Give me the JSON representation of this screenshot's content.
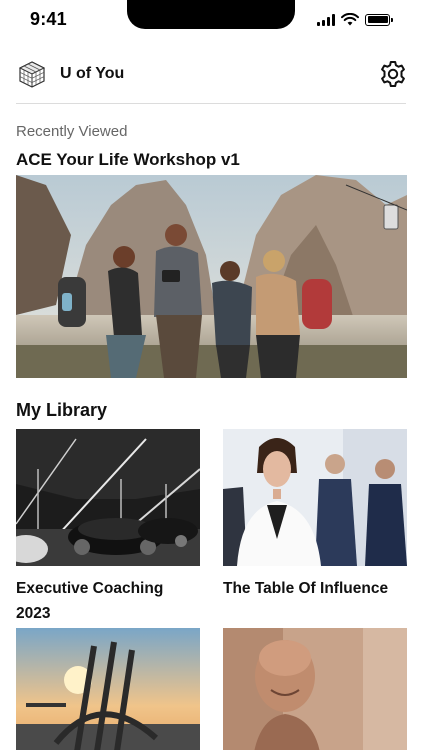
{
  "status_bar": {
    "time": "9:41"
  },
  "app": {
    "title": "U of You"
  },
  "recently_viewed": {
    "section_label": "Recently Viewed",
    "title": "ACE Your Life Workshop v1"
  },
  "library": {
    "section_label": "My Library",
    "items": [
      {
        "title": "Executive Coaching 2023"
      },
      {
        "title": "The Table Of Influence"
      },
      {
        "title": ""
      },
      {
        "title": ""
      }
    ]
  },
  "colors": {
    "text": "#111111",
    "muted": "#666666",
    "divider": "#dcdcdc"
  }
}
